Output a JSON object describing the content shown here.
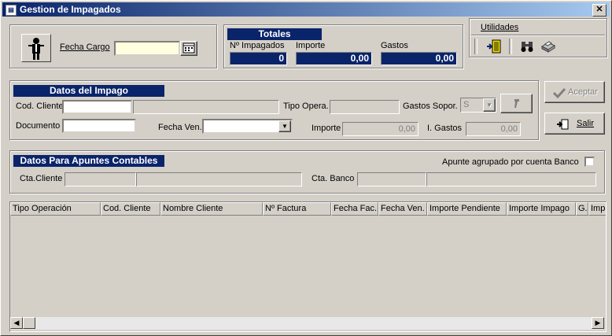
{
  "window": {
    "title": "Gestion de Impagados",
    "close_glyph": "✕"
  },
  "fecha_cargo": {
    "label": "Fecha Cargo",
    "value": ""
  },
  "totales": {
    "title": "Totales",
    "labels": {
      "n_impagados": "Nº Impagados",
      "importe": "Importe",
      "gastos": "Gastos"
    },
    "values": {
      "n_impagados": "0",
      "importe": "0,00",
      "gastos": "0,00"
    }
  },
  "utilidades": {
    "label": "Utilidades"
  },
  "datos_impago": {
    "title": "Datos del Impago",
    "cod_cliente_label": "Cod. Cliente",
    "cod_cliente_value": "",
    "nombre_cliente_value": "",
    "tipo_opera_label": "Tipo Opera.",
    "tipo_opera_value": "",
    "gastos_sopor_label": "Gastos Sopor.",
    "gastos_sopor_value": "S",
    "documento_label": "Documento",
    "documento_value": "",
    "fecha_ven_label": "Fecha Ven.",
    "fecha_ven_value": "",
    "importe_label": "Importe",
    "importe_value": "0,00",
    "i_gastos_label": "I. Gastos",
    "i_gastos_value": "0,00"
  },
  "buttons": {
    "aceptar": "Aceptar",
    "salir": "Salir"
  },
  "apuntes": {
    "title": "Datos Para Apuntes Contables",
    "agrupado_label": "Apunte agrupado por cuenta Banco",
    "agrupado_checked": false,
    "cta_cliente_label": "Cta.Cliente",
    "cta_banco_label": "Cta. Banco"
  },
  "table": {
    "columns": [
      "Tipo Operación",
      "Cod.  Cliente",
      "Nombre Cliente",
      "Nº Factura",
      "Fecha Fac.",
      "Fecha Ven.",
      "Importe Pendiente",
      "Importe Impago",
      "G.",
      "Imp. G"
    ],
    "rows": []
  },
  "icons": {
    "window": "window-icon",
    "person": "person-icon",
    "calendar": "calendar-icon",
    "exit": "exit-door-icon",
    "binoculars": "binoculars-icon",
    "printer": "printer-icon",
    "hammer": "hammer-icon",
    "check": "check-icon",
    "salir": "exit-icon"
  }
}
